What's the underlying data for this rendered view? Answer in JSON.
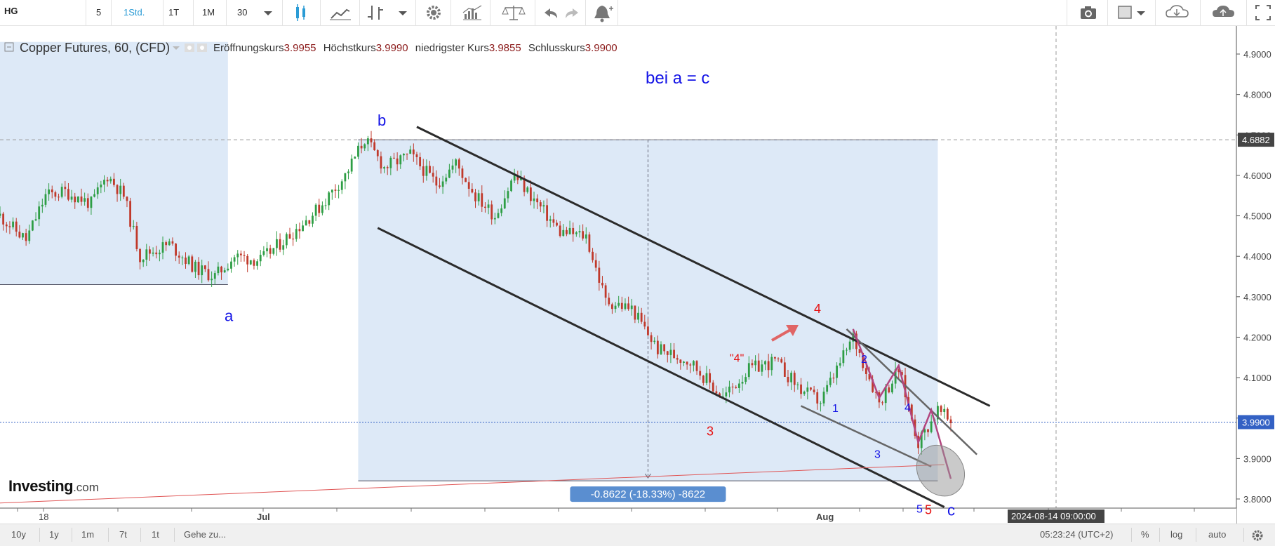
{
  "toolbar": {
    "symbol": "HG",
    "intervals": [
      "5",
      "1Std.",
      "1T",
      "1M",
      "30"
    ],
    "active_interval": "1Std."
  },
  "legend": {
    "instrument": "Copper Futures, 60, (CFD)",
    "open_label": "Eröffnungskurs",
    "open_value": "3.9955",
    "high_label": "Höchstkurs",
    "high_value": "3.9990",
    "low_label": "niedrigster Kurs",
    "low_value": "3.9855",
    "close_label": "Schlusskurs",
    "close_value": "3.9900"
  },
  "annotation": {
    "title": "bei a = c",
    "wave_a": "a",
    "wave_b": "b",
    "wave_c": "c",
    "red_3": "3",
    "red_4": "4",
    "red_4_quoted": "\"4\"",
    "red_5": "5",
    "blue_1": "1",
    "blue_2": "2",
    "blue_3": "3",
    "blue_4": "4",
    "blue_5": "5",
    "measure_label": "-0.8622 (-18.33%) -8622"
  },
  "logo": {
    "text": "Investing",
    "suffix": ".com"
  },
  "price_axis": {
    "ticks": [
      "4.9000",
      "4.8000",
      "4.7000",
      "4.6000",
      "4.5000",
      "4.4000",
      "4.3000",
      "4.2000",
      "4.1000",
      "4.0000",
      "3.9000",
      "3.8000"
    ],
    "highlight_high": "4.6882",
    "highlight_current": "3.9900"
  },
  "time_axis": {
    "labels": [
      "18",
      "Jul",
      "Aug"
    ],
    "crosshair_time": "2024-08-14 09:00:00"
  },
  "statusbar": {
    "ranges": [
      "10y",
      "1y",
      "1m",
      "7t",
      "1t"
    ],
    "goto": "Gehe zu...",
    "clock": "05:23:24 (UTC+2)",
    "percent": "%",
    "log": "log",
    "auto": "auto"
  },
  "colors": {
    "candle_up": "#2e9e45",
    "candle_down": "#c0392b",
    "zone_fill": "#dde9f7",
    "wave_blue": "#1414e6",
    "wave_red": "#e60f0f",
    "channel": "#2b2b2b",
    "impulse": "#b2457e",
    "price_current": "#3361c4"
  },
  "chart_data": {
    "type": "candlestick",
    "title": "Copper Futures, 60, (CFD)",
    "ylim": [
      3.77,
      4.93
    ],
    "y_ticks": [
      3.8,
      3.9,
      4.0,
      4.1,
      4.2,
      4.3,
      4.4,
      4.5,
      4.6,
      4.7,
      4.8,
      4.9
    ],
    "x_ticks": [
      "18",
      "Jul",
      "Aug"
    ],
    "price_path": [
      {
        "t": 0,
        "p": 4.5
      },
      {
        "t": 8,
        "p": 4.44
      },
      {
        "t": 14,
        "p": 4.55
      },
      {
        "t": 20,
        "p": 4.56
      },
      {
        "t": 28,
        "p": 4.53
      },
      {
        "t": 33,
        "p": 4.6
      },
      {
        "t": 38,
        "p": 4.55
      },
      {
        "t": 43,
        "p": 4.4
      },
      {
        "t": 52,
        "p": 4.43
      },
      {
        "t": 60,
        "p": 4.37
      },
      {
        "t": 66,
        "p": 4.35
      },
      {
        "t": 72,
        "p": 4.4
      },
      {
        "t": 80,
        "p": 4.39
      },
      {
        "t": 90,
        "p": 4.46
      },
      {
        "t": 98,
        "p": 4.52
      },
      {
        "t": 106,
        "p": 4.6
      },
      {
        "t": 112,
        "p": 4.69
      },
      {
        "t": 118,
        "p": 4.62
      },
      {
        "t": 126,
        "p": 4.65
      },
      {
        "t": 134,
        "p": 4.58
      },
      {
        "t": 140,
        "p": 4.63
      },
      {
        "t": 146,
        "p": 4.55
      },
      {
        "t": 152,
        "p": 4.5
      },
      {
        "t": 158,
        "p": 4.6
      },
      {
        "t": 166,
        "p": 4.52
      },
      {
        "t": 172,
        "p": 4.46
      },
      {
        "t": 180,
        "p": 4.45
      },
      {
        "t": 186,
        "p": 4.29
      },
      {
        "t": 194,
        "p": 4.27
      },
      {
        "t": 202,
        "p": 4.17
      },
      {
        "t": 212,
        "p": 4.14
      },
      {
        "t": 222,
        "p": 4.05
      },
      {
        "t": 230,
        "p": 4.12
      },
      {
        "t": 238,
        "p": 4.14
      },
      {
        "t": 246,
        "p": 4.07
      },
      {
        "t": 252,
        "p": 4.04
      },
      {
        "t": 262,
        "p": 4.2
      },
      {
        "t": 270,
        "p": 4.04
      },
      {
        "t": 276,
        "p": 4.12
      },
      {
        "t": 282,
        "p": 3.94
      },
      {
        "t": 288,
        "p": 4.02
      },
      {
        "t": 292,
        "p": 3.99
      }
    ],
    "bars_total": 292,
    "zones": [
      {
        "name": "a-range",
        "t_start": 0,
        "t_end": 70,
        "p_high": 4.93,
        "p_low": 4.33
      },
      {
        "name": "measure",
        "t_start": 110,
        "t_end": 288,
        "p_high": 4.6882,
        "p_low": 3.845
      }
    ],
    "measurement": {
      "change": -0.8622,
      "percent": -18.33,
      "ticks": -8622
    },
    "waves": {
      "a": 4.33,
      "b": 4.6882,
      "red_3": 4.04,
      "red_4_quoted": 4.15,
      "red_4": 4.22,
      "blue_1": 4.05,
      "blue_2": 4.13,
      "blue_3": 3.94,
      "blue_4": 4.02,
      "blue_5_target": 3.85
    },
    "channels": [
      {
        "name": "upper",
        "from": {
          "t": 128,
          "p": 4.72
        },
        "to": {
          "t": 304,
          "p": 4.03
        }
      },
      {
        "name": "lower",
        "from": {
          "t": 116,
          "p": 4.47
        },
        "to": {
          "t": 290,
          "p": 3.78
        }
      },
      {
        "name": "wedge-top",
        "from": {
          "t": 260,
          "p": 4.22
        },
        "to": {
          "t": 300,
          "p": 3.91
        }
      },
      {
        "name": "wedge-bottom",
        "from": {
          "t": 246,
          "p": 4.03
        },
        "to": {
          "t": 286,
          "p": 3.88
        }
      },
      {
        "name": "support",
        "from": {
          "t": 0,
          "p": 3.79
        },
        "to": {
          "t": 290,
          "p": 3.885
        }
      }
    ],
    "current_price": 3.99
  }
}
